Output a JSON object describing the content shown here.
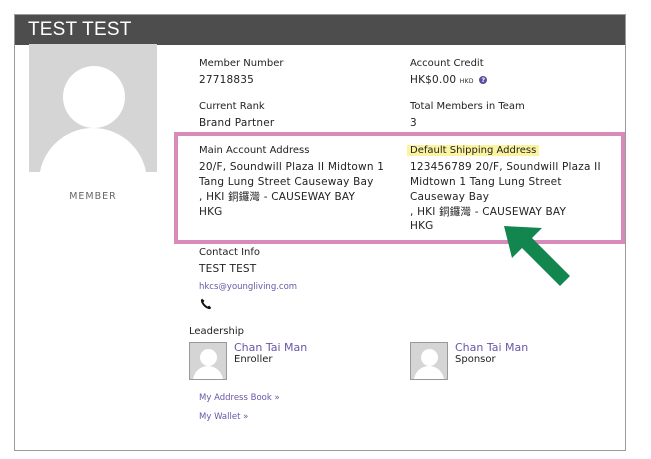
{
  "header": {
    "title": "TEST TEST"
  },
  "member": {
    "label": "MEMBER"
  },
  "fields": {
    "member_number": {
      "label": "Member Number",
      "value": "27718835"
    },
    "account_credit": {
      "label": "Account Credit",
      "value": "HK$0.00",
      "currency": "HKD"
    },
    "current_rank": {
      "label": "Current Rank",
      "value": "Brand Partner"
    },
    "total_members": {
      "label": "Total Members in Team",
      "value": "3"
    }
  },
  "main_address": {
    "label": "Main Account Address",
    "lines": [
      "20/F, Soundwill Plaza II Midtown 1",
      "Tang Lung Street Causeway Bay",
      ", HKI 銅鑼灣 - CAUSEWAY BAY",
      "HKG"
    ]
  },
  "shipping_address": {
    "label": "Default Shipping Address",
    "lines": [
      "123456789 20/F, Soundwill Plaza II",
      "Midtown 1 Tang Lung Street",
      "Causeway Bay",
      ", HKI 銅鑼灣 - CAUSEWAY BAY",
      "HKG"
    ]
  },
  "contact": {
    "label": "Contact Info",
    "name": "TEST TEST",
    "email": "hkcs@youngliving.com"
  },
  "leadership": {
    "title": "Leadership",
    "enroller": {
      "name": "Chan Tai Man",
      "role": "Enroller"
    },
    "sponsor": {
      "name": "Chan Tai Man",
      "role": "Sponsor"
    }
  },
  "links": {
    "address_book": "My Address Book »",
    "wallet": "My Wallet »"
  },
  "colors": {
    "header_bg": "#4d4d4d",
    "highlight_box": "#d88ab9",
    "annotation_arrow": "#12864e",
    "link": "#6a56a8",
    "label_highlight": "#fbf3a0"
  },
  "icons": [
    "help-icon",
    "phone-icon",
    "annotation-arrow-icon"
  ]
}
